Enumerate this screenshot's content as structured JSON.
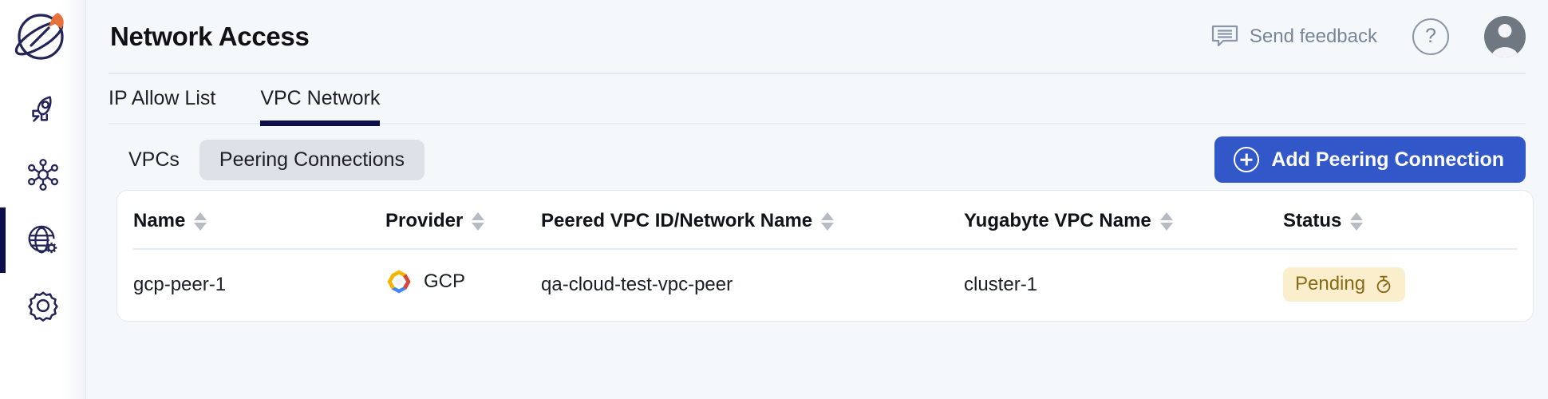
{
  "sidebar": {
    "logo_name": "yugabyte-planet-rocket-logo",
    "items": [
      {
        "name": "sidebar-item-launch",
        "icon": "rocket-icon",
        "active": false
      },
      {
        "name": "sidebar-item-clusters",
        "icon": "cluster-nodes-icon",
        "active": false
      },
      {
        "name": "sidebar-item-network-access",
        "icon": "globe-gear-icon",
        "active": true
      },
      {
        "name": "sidebar-item-settings",
        "icon": "gear-icon",
        "active": false
      }
    ]
  },
  "header": {
    "title": "Network Access",
    "feedback_label": "Send feedback",
    "feedback_icon": "comment-lines-icon",
    "help_label": "?",
    "help_icon": "question-circle-icon",
    "avatar_icon": "user-avatar-icon"
  },
  "tabs": [
    {
      "label": "IP Allow List",
      "active": false
    },
    {
      "label": "VPC Network",
      "active": true
    }
  ],
  "toolbar": {
    "segments": [
      {
        "label": "VPCs",
        "active": false
      },
      {
        "label": "Peering Connections",
        "active": true
      }
    ],
    "add_button_label": "Add Peering Connection",
    "add_button_icon": "plus-circle-icon"
  },
  "table": {
    "columns": [
      {
        "label": "Name",
        "sortable": true
      },
      {
        "label": "Provider",
        "sortable": true
      },
      {
        "label": "Peered VPC ID/Network Name",
        "sortable": true
      },
      {
        "label": "Yugabyte VPC Name",
        "sortable": true
      },
      {
        "label": "Status",
        "sortable": true
      }
    ],
    "rows": [
      {
        "name": "gcp-peer-1",
        "provider": "GCP",
        "provider_icon": "gcp-hexagon-icon",
        "peered_vpc": "qa-cloud-test-vpc-peer",
        "yugabyte_vpc": "cluster-1",
        "status": "Pending",
        "status_icon": "stopwatch-icon"
      }
    ]
  },
  "colors": {
    "accent_blue": "#3257c8",
    "navy": "#0e0f4a",
    "page_bg": "#f5f8fb",
    "card_bg": "#ffffff",
    "badge_bg": "#fbeecc",
    "badge_fg": "#8a6a15",
    "muted_text": "#78869a",
    "logo_orange": "#e8703a"
  }
}
